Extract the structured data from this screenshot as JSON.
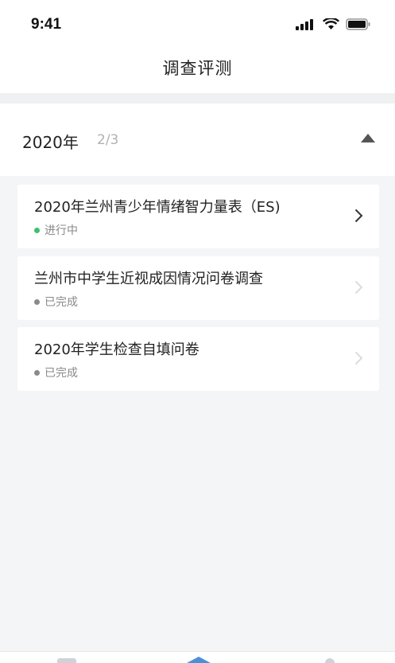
{
  "status_bar": {
    "time": "9:41",
    "icons": [
      "signal-icon",
      "wifi-icon",
      "battery-icon"
    ]
  },
  "nav": {
    "title": "调查评测"
  },
  "section": {
    "year": "2020年",
    "count": "2/3",
    "collapse_icon": "triangle-up-icon"
  },
  "surveys": [
    {
      "title": "2020年兰州青少年情绪智力量表（ES)",
      "status": "进行中",
      "status_color": "#3cc36a",
      "enabled": true
    },
    {
      "title": "兰州市中学生近视成因情况问卷调查",
      "status": "已完成",
      "status_color": "#8a8a8a",
      "enabled": false
    },
    {
      "title": "2020年学生检查自填问卷",
      "status": "已完成",
      "status_color": "#8a8a8a",
      "enabled": false
    }
  ],
  "tab_bar": {
    "icons": [
      "document-icon",
      "home-icon",
      "profile-icon"
    ],
    "active_color": "#4a90d9"
  }
}
